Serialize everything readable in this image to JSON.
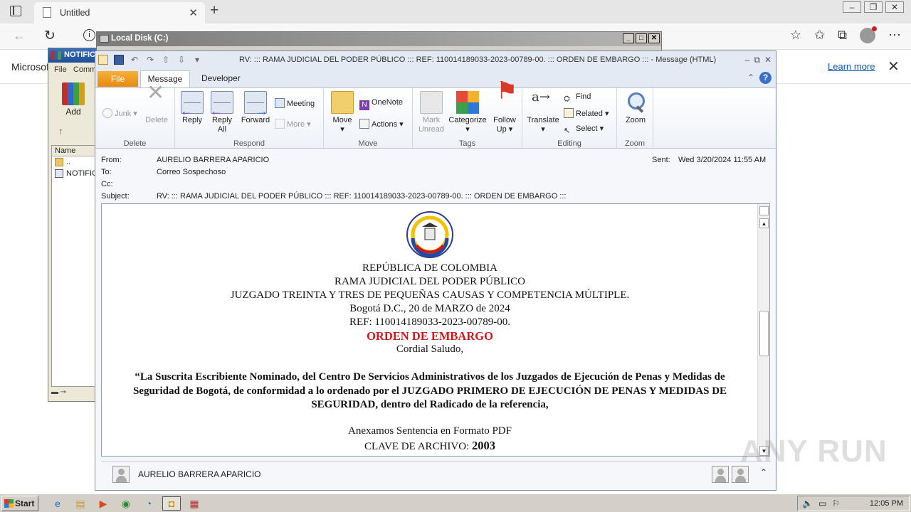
{
  "browser": {
    "tab_title": "Untitled",
    "infobar_text": "Microsoft",
    "infobar_link": "Learn more"
  },
  "winrar": {
    "title": "NOTIFIC",
    "menu": [
      "File",
      "Comm"
    ],
    "add_label": "Add",
    "column_name": "Name",
    "rows": [
      "..",
      "NOTIFIC"
    ]
  },
  "explorer": {
    "title": "Local Disk (C:)"
  },
  "outlook": {
    "window_title": "RV: ::: RAMA JUDICIAL DEL PODER PÚBLICO ::: REF: 110014189033-2023-00789-00. ::: ORDEN DE EMBARGO ::: -  Message (HTML)",
    "tabs": {
      "file": "File",
      "message": "Message",
      "developer": "Developer"
    },
    "ribbon": {
      "delete_group": {
        "label": "Delete",
        "junk": "Junk",
        "delete": "Delete"
      },
      "respond_group": {
        "label": "Respond",
        "reply": "Reply",
        "reply_all_1": "Reply",
        "reply_all_2": "All",
        "forward": "Forward",
        "meeting": "Meeting",
        "more": "More"
      },
      "move_group": {
        "label": "Move",
        "move": "Move",
        "onenote": "OneNote",
        "actions": "Actions"
      },
      "tags_group": {
        "label": "Tags",
        "mark_unread_1": "Mark",
        "mark_unread_2": "Unread",
        "categorize": "Categorize",
        "follow_up_1": "Follow",
        "follow_up_2": "Up"
      },
      "editing_group": {
        "label": "Editing",
        "translate": "Translate",
        "find": "Find",
        "related": "Related",
        "select": "Select"
      },
      "zoom_group": {
        "label": "Zoom",
        "zoom": "Zoom"
      }
    },
    "header": {
      "from_label": "From:",
      "from_value": "AURELIO  BARRERA APARICIO",
      "to_label": "To:",
      "to_value": "Correo Sospechoso",
      "cc_label": "Cc:",
      "subject_label": "Subject:",
      "subject_value": "RV: ::: RAMA JUDICIAL DEL PODER PÚBLICO ::: REF: 110014189033-2023-00789-00. ::: ORDEN DE EMBARGO :::",
      "sent_label": "Sent:",
      "sent_value": "Wed 3/20/2024 11:55 AM"
    },
    "body": {
      "line1": "REPÚBLICA DE COLOMBIA",
      "line2": "RAMA JUDICIAL DEL PODER PÚBLICO",
      "line3": "JUZGADO TREINTA Y TRES DE PEQUEÑAS CAUSAS Y COMPETENCIA MÚLTIPLE.",
      "line4": "Bogotá D.C.,  20 de MARZO de 2024",
      "line5": "REF: 110014189033-2023-00789-00.",
      "line6": "ORDEN DE EMBARGO",
      "line7": "Cordial Saludo,",
      "paragraph": "“La Suscrita Escribiente Nominado, del Centro De Servicios Administrativos de los Juzgados de Ejecución de Penas y Medidas de Seguridad de Bogotá, de conformidad a lo ordenado por el JUZGADO PRIMERO DE EJECUCIÓN DE PENAS Y MEDIDAS DE SEGURIDAD, dentro del Radicado de la referencia,",
      "line8": "Anexamos Sentencia en Formato PDF",
      "line9_prefix": "CLAVE DE ARCHIVO: ",
      "line9_code": "2003"
    },
    "people_pane_name": "AURELIO  BARRERA APARICIO"
  },
  "taskbar": {
    "start": "Start",
    "clock": "12:05 PM"
  },
  "watermark": "ANY RUN"
}
